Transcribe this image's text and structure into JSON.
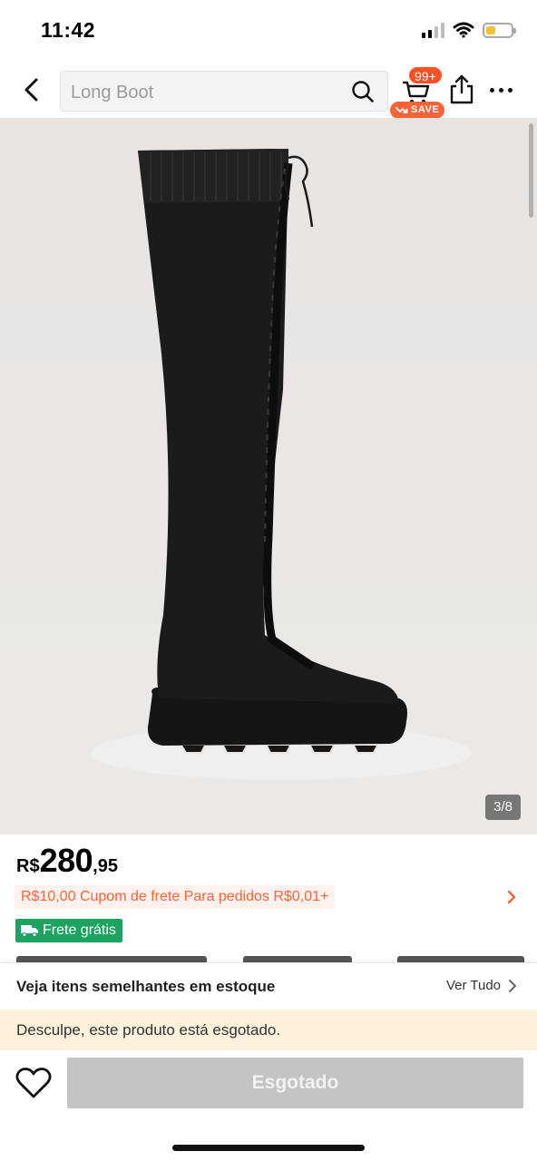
{
  "status_bar": {
    "time": "11:42"
  },
  "header": {
    "search_text": "Long Boot",
    "cart_badge": "99+",
    "save_label": "SAVE"
  },
  "product": {
    "image_counter": "3/8",
    "price_currency": "R$",
    "price_integer": "280",
    "price_decimal": ",95",
    "coupon_text": "R$10,00 Cupom de frete Para pedidos R$0,01+",
    "free_shipping": "Frete grátis"
  },
  "similar": {
    "title": "Veja itens semelhantes em estoque",
    "see_all": "Ver Tudo"
  },
  "stock_notice": "Desculpe, este produto está esgotado.",
  "action": {
    "sold_out_label": "Esgotado"
  },
  "colors": {
    "accent_orange": "#fa6338",
    "badge_red": "#fe4f25",
    "free_ship_green": "#1ca361",
    "notice_bg": "#fbf1dc",
    "disabled_button": "#c4c4c4"
  },
  "icons": [
    "back-arrow-icon",
    "search-icon",
    "cart-icon",
    "save-arrow-icon",
    "share-icon",
    "more-icon",
    "truck-icon",
    "chevron-right-icon",
    "heart-icon"
  ]
}
